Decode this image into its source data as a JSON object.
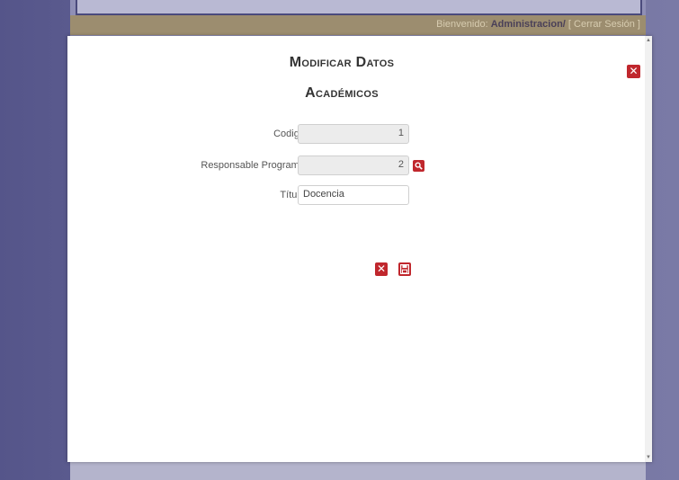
{
  "header": {
    "welcome_text": "Bienvenido:",
    "user_name": "Administracion/",
    "logout_text": "[ Cerrar Sesión ]"
  },
  "modal": {
    "title_line1": "Modificar Datos",
    "title_line2": "Académicos",
    "close_icon": "close-icon"
  },
  "form": {
    "codigo": {
      "label": "Codigo:",
      "value": "1"
    },
    "responsable": {
      "label": "Responsable Programa:",
      "value": "2",
      "lookup_icon": "search-icon"
    },
    "titulo": {
      "label": "Título:",
      "value": "Docencia"
    }
  },
  "actions": {
    "cancel_icon": "close-icon",
    "save_icon": "save-icon"
  },
  "colors": {
    "accent": "#c0272d",
    "welcome_bar": "#9c8d6f",
    "backdrop": "#6d6d9c"
  }
}
